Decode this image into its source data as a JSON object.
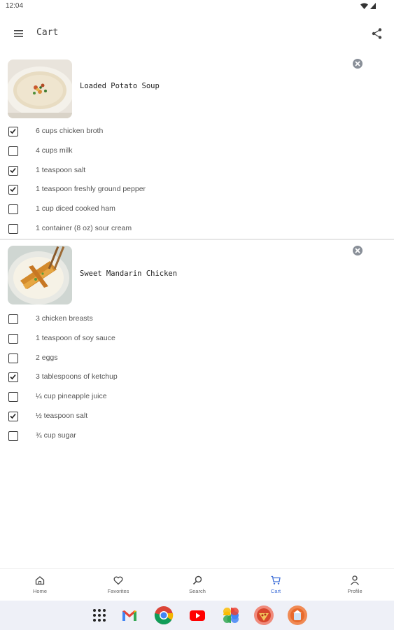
{
  "status_bar": {
    "time": "12:04"
  },
  "app_bar": {
    "title": "Cart"
  },
  "recipes": [
    {
      "title": "Loaded Potato Soup",
      "ingredients": [
        {
          "label": "6 cups chicken broth",
          "checked": true
        },
        {
          "label": "4 cups milk",
          "checked": false
        },
        {
          "label": "1 teaspoon salt",
          "checked": true
        },
        {
          "label": "1 teaspoon freshly ground pepper",
          "checked": true
        },
        {
          "label": "1 cup diced cooked ham",
          "checked": false
        },
        {
          "label": "1 container (8 oz) sour cream",
          "checked": false
        }
      ]
    },
    {
      "title": "Sweet Mandarin Chicken",
      "ingredients": [
        {
          "label": "3 chicken breasts",
          "checked": false
        },
        {
          "label": "1 teaspoon of soy sauce",
          "checked": false
        },
        {
          "label": "2 eggs",
          "checked": false
        },
        {
          "label": "3 tablespoons of ketchup",
          "checked": true
        },
        {
          "label": "¼ cup pineapple juice",
          "checked": false
        },
        {
          "label": "½ teaspoon salt",
          "checked": true
        },
        {
          "label": "¾ cup sugar",
          "checked": false
        }
      ]
    }
  ],
  "bottom_nav": [
    {
      "label": "Home",
      "icon": "home-icon",
      "active": false
    },
    {
      "label": "Favorites",
      "icon": "heart-icon",
      "active": false
    },
    {
      "label": "Search",
      "icon": "search-icon",
      "active": false
    },
    {
      "label": "Cart",
      "icon": "cart-icon",
      "active": true
    },
    {
      "label": "Profile",
      "icon": "person-icon",
      "active": false
    }
  ],
  "dock": [
    "app-drawer-icon",
    "gmail-icon",
    "chrome-icon",
    "youtube-icon",
    "photos-icon",
    "pizza-app-icon",
    "recipe-app-icon"
  ],
  "colors": {
    "accent": "#3f6fd8",
    "remove_button": "#8a9099",
    "dock_background": "#eef0f7"
  }
}
